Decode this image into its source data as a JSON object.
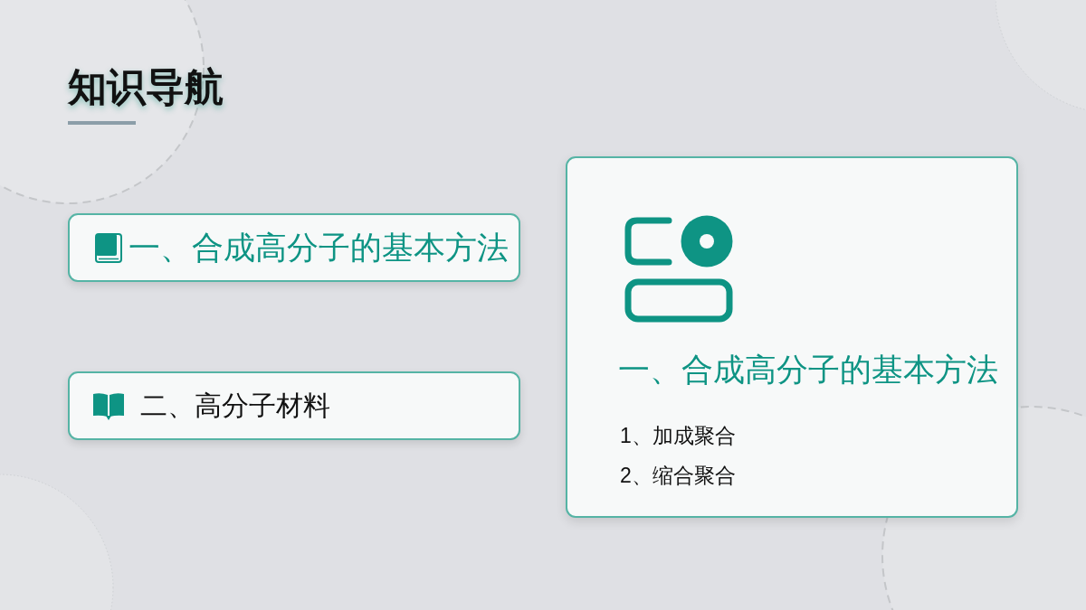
{
  "title": "知识导航",
  "nav_items": [
    {
      "label": "一、合成高分子的基本方法",
      "selected": true
    },
    {
      "label": "二、高分子材料",
      "selected": false
    }
  ],
  "detail_panel": {
    "heading": "一、合成高分子的基本方法",
    "items": [
      "1、加成聚合",
      "2、缩合聚合"
    ]
  }
}
